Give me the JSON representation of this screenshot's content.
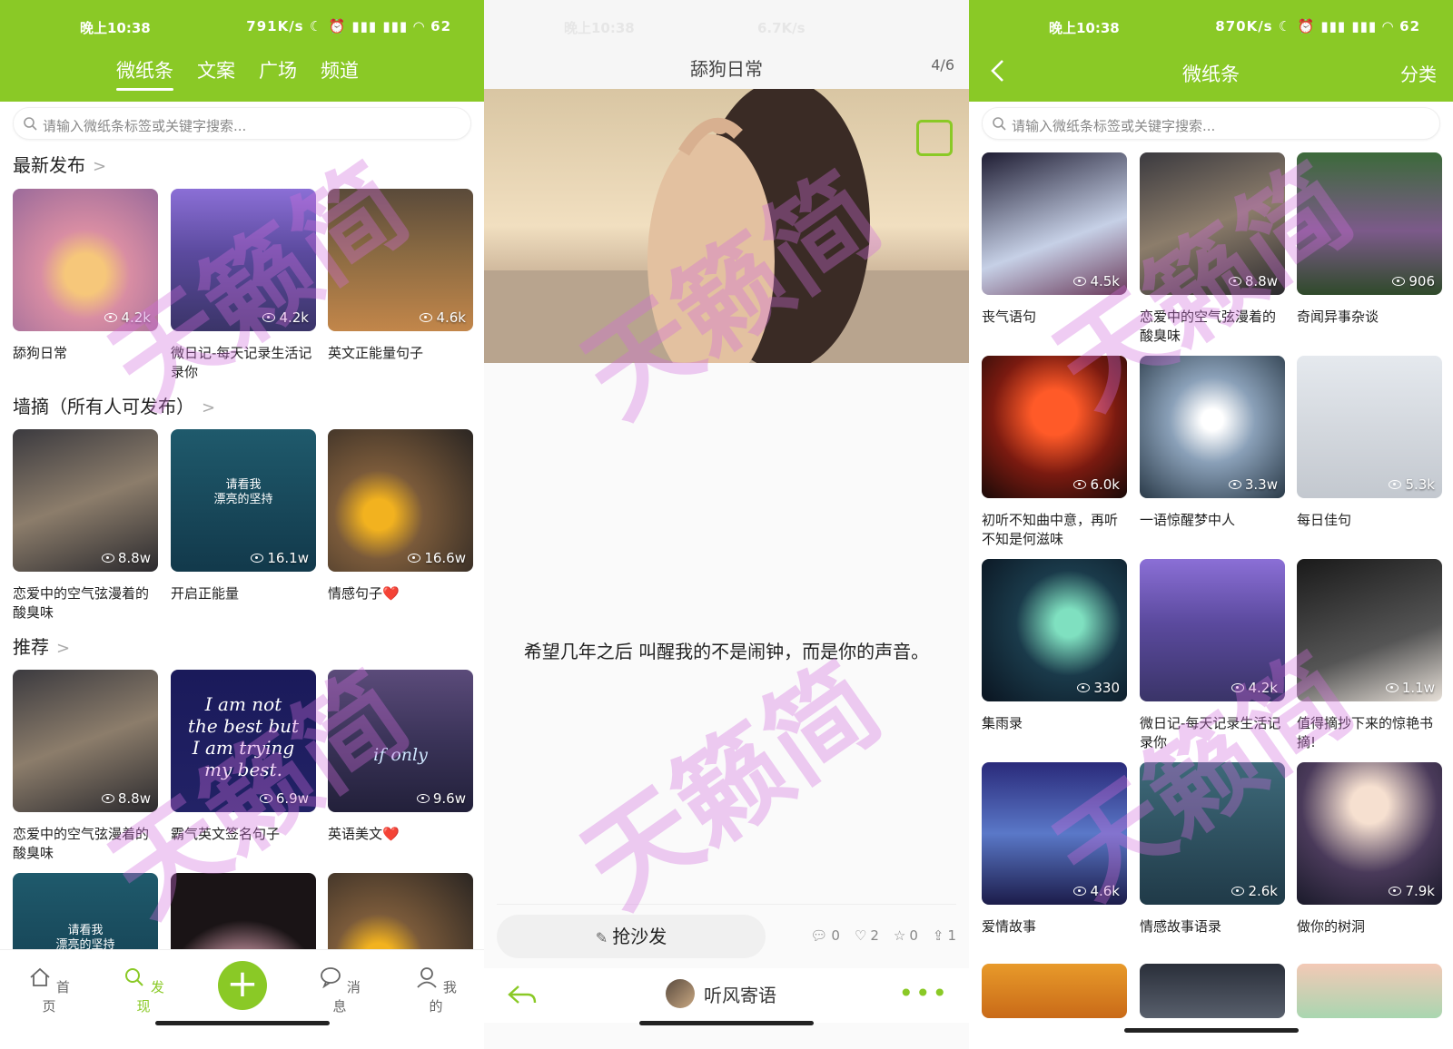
{
  "panel1": {
    "status": {
      "time": "晚上10:38",
      "net": "791K/s  ☾ ⏰ ▮▮▮ ▮▮▮ ◠ 62"
    },
    "tabs": [
      "微纸条",
      "文案",
      "广场",
      "频道"
    ],
    "search_placeholder": "请输入微纸条标签或关键字搜索...",
    "sections": [
      {
        "title": "最新发布",
        "items": [
          {
            "caption": "舔狗日常",
            "views": "4.2k"
          },
          {
            "caption": "微日记-每天记录生活记录你",
            "views": "4.2k"
          },
          {
            "caption": "英文正能量句子",
            "views": "4.6k"
          }
        ]
      },
      {
        "title": "墙摘（所有人可发布）",
        "items": [
          {
            "caption": "恋爱中的空气弦漫着的酸臭味",
            "views": "8.8w"
          },
          {
            "caption": "开启正能量",
            "views": "16.1w",
            "overlay": "请看我\n漂亮的坚持"
          },
          {
            "caption": "情感句子❤️",
            "views": "16.6w"
          }
        ]
      },
      {
        "title": "推荐",
        "items": [
          {
            "caption": "恋爱中的空气弦漫着的酸臭味",
            "views": "8.8w"
          },
          {
            "caption": "霸气英文签名句子",
            "views": "6.9w",
            "overlay": "I am not\nthe best but\nI am trying\nmy best."
          },
          {
            "caption": "英语美文❤️",
            "views": "9.6w",
            "overlay": "if only"
          }
        ]
      }
    ],
    "partial_row": [
      {
        "overlay": "请看我\n漂亮的坚持"
      },
      {
        "overlay": ""
      },
      {
        "overlay": ""
      }
    ],
    "nav": [
      "首页",
      "发现",
      "消息",
      "我的"
    ],
    "plus": "+"
  },
  "panel2": {
    "status": {
      "time": "晚上10:38",
      "net": "6.7K/s"
    },
    "title": "舔狗日常",
    "counter": "4/6",
    "quote": "希望几年之后 叫醒我的不是闹钟，而是你的声音。",
    "sofa_label": "抢沙发",
    "stats": {
      "comments": "0",
      "likes": "2",
      "stars": "0",
      "shares": "1"
    },
    "author": "听风寄语",
    "more": "•••"
  },
  "panel3": {
    "status": {
      "time": "晚上10:38",
      "net": "870K/s  ☾ ⏰ ▮▮▮ ▮▮▮ ◠ 62"
    },
    "title": "微纸条",
    "category": "分类",
    "search_placeholder": "请输入微纸条标签或关键字搜索...",
    "grid": [
      {
        "caption": "丧气语句",
        "views": "4.5k"
      },
      {
        "caption": "恋爱中的空气弦漫着的酸臭味",
        "views": "8.8w"
      },
      {
        "caption": "奇闻异事杂谈",
        "views": "906"
      },
      {
        "caption": "初听不知曲中意，再听不知是何滋味",
        "views": "6.0k"
      },
      {
        "caption": "一语惊醒梦中人",
        "views": "3.3w"
      },
      {
        "caption": "每日佳句",
        "views": "5.3k"
      },
      {
        "caption": "集雨录",
        "views": "330"
      },
      {
        "caption": "微日记-每天记录生活记录你",
        "views": "4.2k"
      },
      {
        "caption": "值得摘抄下来的惊艳书摘!",
        "views": "1.1w"
      },
      {
        "caption": "爱情故事",
        "views": "4.6k"
      },
      {
        "caption": "情感故事语录",
        "views": "2.6k"
      },
      {
        "caption": "做你的树洞",
        "views": "7.9k"
      }
    ]
  },
  "watermark": "天籁简",
  "colors": {
    "accent": "#8ac926"
  }
}
